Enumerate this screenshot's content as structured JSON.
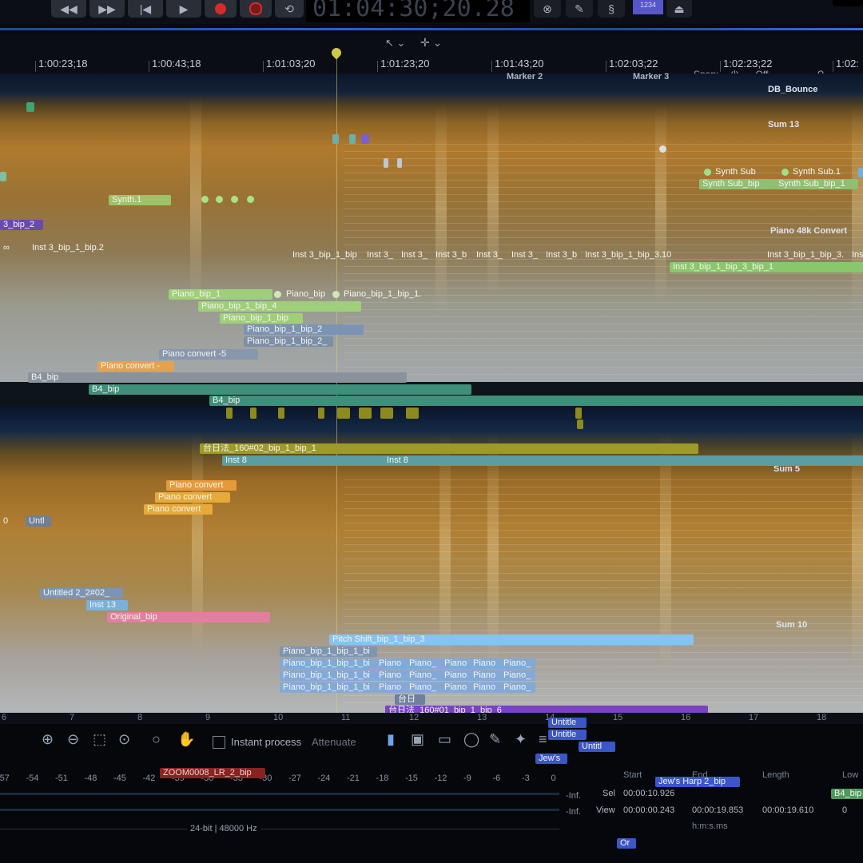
{
  "transport": {
    "timecode": "01:04:30;20.28",
    "lcd": "1234",
    "buttons": [
      "rewind",
      "fast-forward",
      "go-to-start",
      "play",
      "record",
      "record-armed",
      "cycle"
    ]
  },
  "ruler": {
    "ticks": [
      "1:00:23;18",
      "1:00:43;18",
      "1:01:03;20",
      "1:01:23;20",
      "1:01:43;20",
      "1:02:03;22",
      "1:02:23;22",
      "1:02:"
    ],
    "markers": [
      "Marker 2",
      "Marker 3"
    ],
    "snap_label": "Snap:",
    "snap_value": "Off"
  },
  "tracks": {
    "db_bounce": "DB_Bounce",
    "sum13": "Sum 13",
    "piano48k": "Piano 48k Convert",
    "sum5": "Sum 5",
    "sum10": "Sum 10"
  },
  "clips": {
    "inst3_bip_2": "3_bip_2",
    "synth1": "Synth.1",
    "inst3_bip1_bip2": "Inst 3_bip_1_bip.2",
    "synth_sub": "Synth Sub",
    "synth_sub1": "Synth Sub.1",
    "synth_sub_bip": "Synth Sub_bip",
    "synth_sub_bip_1": "Synth Sub_bip_1",
    "inst3_row": [
      "Inst 3_bip_1_bip",
      "Inst 3_",
      "Inst 3_",
      "Inst 3_b",
      "Inst 3_",
      "Inst 3_",
      "Inst 3_b",
      "Inst 3_bip_1_bip_3.10"
    ],
    "inst3_right": "Inst 3_bip_1_bip_3.",
    "inst3_right2": "Ins",
    "inst3_green": "Inst 3_bip_1_bip_3_bip_1",
    "piano_bip_1": "Piano_bip_1",
    "piano_bip": "Piano_bip",
    "piano_bip_1_bip_1": "Piano_bip_1_bip_1.",
    "piano_bip_1_bip_4": "Piano_bip_1_bip_4",
    "piano_bip_1_bip": "Piano_bip_1_bip",
    "piano_bip_1_bip_2": "Piano_bip_1_bip_2",
    "piano_bip_1_bip_2_": "Piano_bip_1_bip_2_",
    "piano_convert_5": "Piano convert -5",
    "piano_convert_orange": "Piano convert -",
    "b4_bip": "B4_bip",
    "b4_bip2": "B4_bip",
    "b4_bip3": "B4_bip",
    "kanji_bip": "台日法_160#02_bip_1_bip_1",
    "inst8": "Inst 8",
    "inst8b": "Inst 8",
    "piano_convert_a": "Piano convert",
    "piano_convert_b": "Piano convert",
    "piano_convert_c": "Piano convert",
    "untitled_left": "Untl",
    "zero": "0",
    "untitled_2": "Untitled 2_2#02_",
    "inst13": "Inst 13",
    "original_bip": "Original_bip",
    "pitch_shift": "Pitch Shift_bip_1_bip_3",
    "piano_bip_bi": "Piano_bip_1_bip_1_bi",
    "piano_short": "Piano_",
    "piano_mid": "Piano",
    "kanji_small": "台日",
    "kanji_purple": "台日法_160#01_bip_1_bip_6",
    "untitle_a": "Untitle",
    "untitle_b": "Untitle",
    "untitl": "Untitl",
    "jews": "Jew's",
    "jews_harp": "Jew's Harp 2_bip",
    "zoom_clip": "ZOOM0008_LR_2_bip",
    "b4_bip_small": "B4_bip",
    "or": "Or"
  },
  "bottom_ticks": [
    "6",
    "7",
    "8",
    "9",
    "10",
    "11",
    "12",
    "13",
    "14",
    "15",
    "16",
    "17",
    "18"
  ],
  "toolbar": {
    "instant_process": "Instant process",
    "attenuate": "Attenuate"
  },
  "meter": {
    "scale": [
      "-57",
      "-54",
      "-51",
      "-48",
      "-45",
      "-42",
      "-39",
      "-36",
      "-33",
      "-30",
      "-27",
      "-24",
      "-21",
      "-18",
      "-15",
      "-12",
      "-9",
      "-6",
      "-3",
      "0"
    ],
    "inf1": "-Inf.",
    "inf2": "-Inf.",
    "format": "24-bit | 48000 Hz"
  },
  "selection": {
    "col_start": "Start",
    "col_end": "End",
    "col_length": "Length",
    "col_low": "Low",
    "sel_label": "Sel",
    "view_label": "View",
    "sel_start": "00:00:10.926",
    "view_start": "00:00:00.243",
    "view_end": "00:00:19.853",
    "view_length": "00:00:19.610",
    "view_low": "0",
    "units": "h:m:s.ms"
  }
}
